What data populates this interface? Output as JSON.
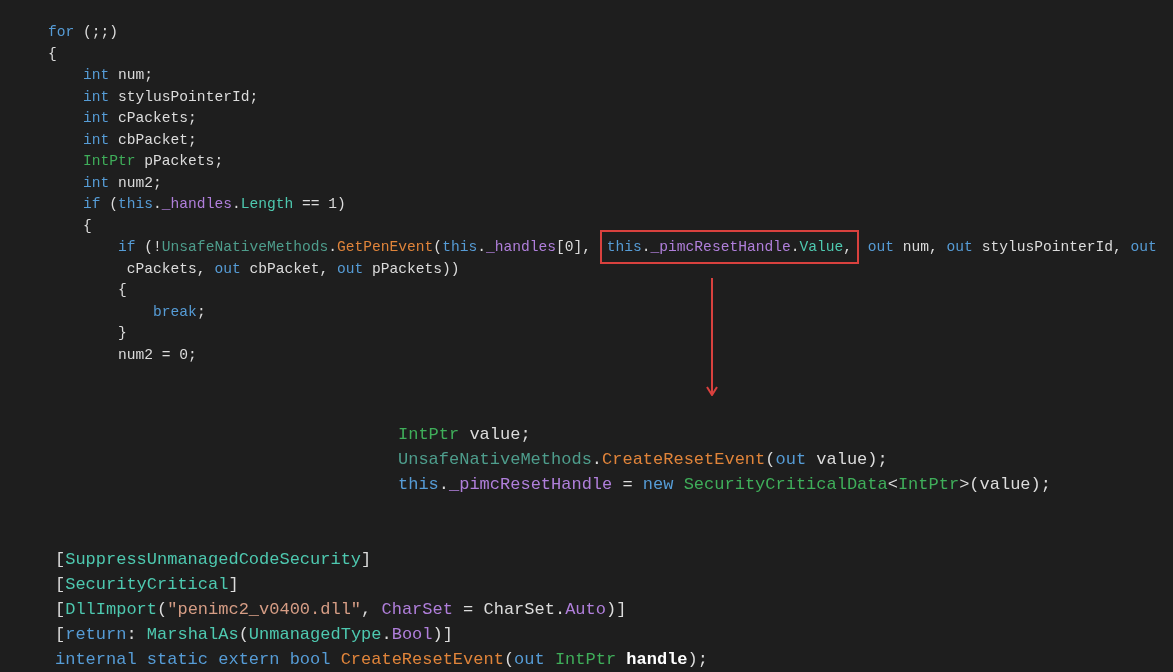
{
  "loop_code": [
    {
      "tokens": [
        {
          "text": "for",
          "kind": "keyword"
        },
        {
          "text": " (;;)",
          "kind": "plain"
        }
      ]
    },
    {
      "tokens": [
        {
          "text": "{",
          "kind": "plain"
        }
      ],
      "children": [
        {
          "tokens": [
            {
              "text": "int",
              "kind": "keyword"
            },
            {
              "text": " num;",
              "kind": "plain"
            }
          ]
        },
        {
          "tokens": [
            {
              "text": "int",
              "kind": "keyword"
            },
            {
              "text": " stylusPointerId;",
              "kind": "plain"
            }
          ]
        },
        {
          "tokens": [
            {
              "text": "int",
              "kind": "keyword"
            },
            {
              "text": " cPackets;",
              "kind": "plain"
            }
          ]
        },
        {
          "tokens": [
            {
              "text": "int",
              "kind": "keyword"
            },
            {
              "text": " cbPacket;",
              "kind": "plain"
            }
          ]
        },
        {
          "tokens": [
            {
              "text": "IntPtr",
              "kind": "type"
            },
            {
              "text": " pPackets;",
              "kind": "plain"
            }
          ]
        },
        {
          "tokens": [
            {
              "text": "int",
              "kind": "keyword"
            },
            {
              "text": " num2;",
              "kind": "plain"
            }
          ]
        },
        {
          "tokens": [
            {
              "text": "if",
              "kind": "keyword"
            },
            {
              "text": " (",
              "kind": "plain"
            },
            {
              "text": "this",
              "kind": "keyword"
            },
            {
              "text": ".",
              "kind": "plain"
            },
            {
              "text": "_handles",
              "kind": "field"
            },
            {
              "text": ".",
              "kind": "plain"
            },
            {
              "text": "Length",
              "kind": "property"
            },
            {
              "text": " == 1)",
              "kind": "plain"
            }
          ]
        },
        {
          "tokens": [
            {
              "text": "{",
              "kind": "plain"
            }
          ],
          "children": [
            {
              "tokens": [
                {
                  "text": "if",
                  "kind": "keyword"
                },
                {
                  "text": " (!",
                  "kind": "plain"
                },
                {
                  "text": "UnsafeNativeMethods",
                  "kind": "class"
                },
                {
                  "text": ".",
                  "kind": "plain"
                },
                {
                  "text": "GetPenEvent",
                  "kind": "method"
                },
                {
                  "text": "(",
                  "kind": "plain"
                },
                {
                  "text": "this",
                  "kind": "keyword"
                },
                {
                  "text": ".",
                  "kind": "plain"
                },
                {
                  "text": "_handles",
                  "kind": "field"
                },
                {
                  "text": "[0], ",
                  "kind": "plain"
                }
              ],
              "box": [
                {
                  "text": "this",
                  "kind": "keyword"
                },
                {
                  "text": ".",
                  "kind": "plain"
                },
                {
                  "text": "_pimcResetHandle",
                  "kind": "field"
                },
                {
                  "text": ".",
                  "kind": "plain"
                },
                {
                  "text": "Value",
                  "kind": "property"
                },
                {
                  "text": ",",
                  "kind": "plain"
                }
              ],
              "after": [
                {
                  "text": " out",
                  "kind": "keyword"
                },
                {
                  "text": " num, ",
                  "kind": "plain"
                },
                {
                  "text": "out",
                  "kind": "keyword"
                },
                {
                  "text": " stylusPointerId, ",
                  "kind": "plain"
                },
                {
                  "text": "out",
                  "kind": "keyword"
                }
              ],
              "continuation": [
                {
                  "text": "cPackets, ",
                  "kind": "plain"
                },
                {
                  "text": "out",
                  "kind": "keyword"
                },
                {
                  "text": " cbPacket, ",
                  "kind": "plain"
                },
                {
                  "text": "out",
                  "kind": "keyword"
                },
                {
                  "text": " pPackets))",
                  "kind": "plain"
                }
              ]
            },
            {
              "tokens": [
                {
                  "text": "{",
                  "kind": "plain"
                }
              ],
              "children": [
                {
                  "tokens": [
                    {
                      "text": "break",
                      "kind": "keyword"
                    },
                    {
                      "text": ";",
                      "kind": "plain"
                    }
                  ]
                }
              ]
            },
            {
              "tokens": [
                {
                  "text": "}",
                  "kind": "plain"
                }
              ]
            },
            {
              "tokens": [
                {
                  "text": "num2 = 0;",
                  "kind": "plain"
                }
              ]
            }
          ]
        }
      ]
    }
  ],
  "init_code": [
    {
      "tokens": [
        {
          "text": "IntPtr",
          "kind": "type"
        },
        {
          "text": " value;",
          "kind": "plain"
        }
      ]
    },
    {
      "tokens": [
        {
          "text": "UnsafeNativeMethods",
          "kind": "class"
        },
        {
          "text": ".",
          "kind": "plain"
        },
        {
          "text": "CreateResetEvent",
          "kind": "method"
        },
        {
          "text": "(",
          "kind": "plain"
        },
        {
          "text": "out",
          "kind": "keyword"
        },
        {
          "text": " value);",
          "kind": "plain"
        }
      ]
    },
    {
      "tokens": [
        {
          "text": "this",
          "kind": "keyword"
        },
        {
          "text": ".",
          "kind": "plain"
        },
        {
          "text": "_pimcResetHandle",
          "kind": "field"
        },
        {
          "text": " = ",
          "kind": "plain"
        },
        {
          "text": "new ",
          "kind": "keyword"
        },
        {
          "text": "SecurityCriticalData",
          "kind": "type"
        },
        {
          "text": "<",
          "kind": "plain"
        },
        {
          "text": "IntPtr",
          "kind": "type"
        },
        {
          "text": ">(value);",
          "kind": "plain"
        }
      ]
    }
  ],
  "declaration_code": [
    {
      "tokens": [
        {
          "text": "[",
          "kind": "plain"
        },
        {
          "text": "SuppressUnmanagedCodeSecurity",
          "kind": "property"
        },
        {
          "text": "]",
          "kind": "plain"
        }
      ]
    },
    {
      "tokens": [
        {
          "text": "[",
          "kind": "plain"
        },
        {
          "text": "SecurityCritical",
          "kind": "property"
        },
        {
          "text": "]",
          "kind": "plain"
        }
      ]
    },
    {
      "tokens": [
        {
          "text": "[",
          "kind": "plain"
        },
        {
          "text": "DllImport",
          "kind": "property"
        },
        {
          "text": "(",
          "kind": "plain"
        },
        {
          "text": "\"penimc2_v0400.dll\"",
          "kind": "string"
        },
        {
          "text": ", ",
          "kind": "plain"
        },
        {
          "text": "CharSet",
          "kind": "field"
        },
        {
          "text": " = CharSet.",
          "kind": "plain"
        },
        {
          "text": "Auto",
          "kind": "field"
        },
        {
          "text": ")]",
          "kind": "plain"
        }
      ]
    },
    {
      "tokens": [
        {
          "text": "[",
          "kind": "plain"
        },
        {
          "text": "return",
          "kind": "keyword"
        },
        {
          "text": ": ",
          "kind": "plain"
        },
        {
          "text": "MarshalAs",
          "kind": "property"
        },
        {
          "text": "(",
          "kind": "plain"
        },
        {
          "text": "UnmanagedType",
          "kind": "property"
        },
        {
          "text": ".",
          "kind": "plain"
        },
        {
          "text": "Bool",
          "kind": "field"
        },
        {
          "text": ")]",
          "kind": "plain"
        }
      ]
    },
    {
      "tokens": [
        {
          "text": "internal static extern bool ",
          "kind": "keyword"
        },
        {
          "text": "CreateResetEvent",
          "kind": "method"
        },
        {
          "text": "(",
          "kind": "plain"
        },
        {
          "text": "out ",
          "kind": "keyword"
        },
        {
          "text": "IntPtr ",
          "kind": "type"
        },
        {
          "text": "handle",
          "kind": "param"
        },
        {
          "text": ");",
          "kind": "plain"
        }
      ]
    }
  ]
}
